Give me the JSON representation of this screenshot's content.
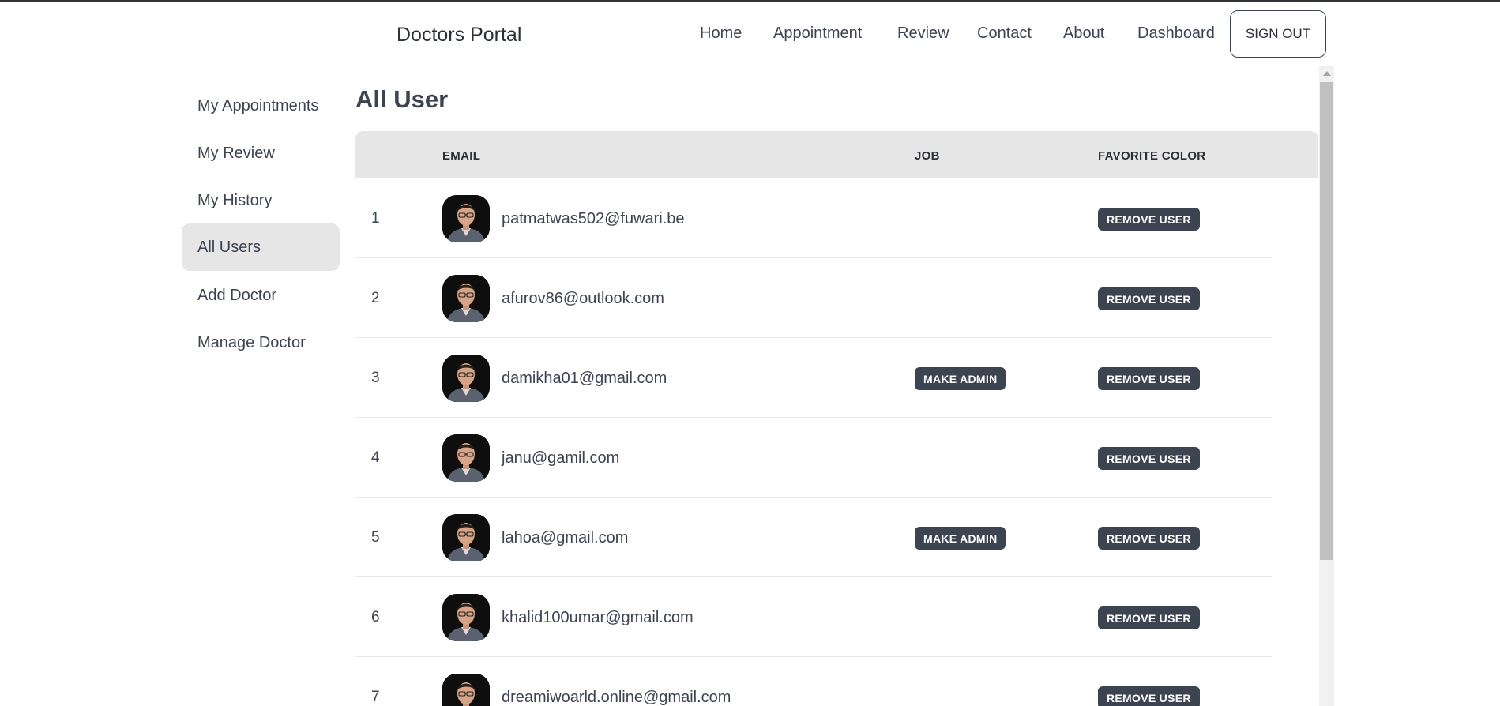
{
  "header": {
    "brand": "Doctors Portal",
    "nav": [
      "Home",
      "Appointment",
      "Review",
      "Contact",
      "About",
      "Dashboard"
    ],
    "signout_label": "SIGN OUT"
  },
  "sidebar": {
    "items": [
      {
        "label": "My Appointments"
      },
      {
        "label": "My Review"
      },
      {
        "label": "My History"
      },
      {
        "label": "All Users",
        "active": true
      },
      {
        "label": "Add Doctor"
      },
      {
        "label": "Manage Doctor"
      }
    ]
  },
  "main": {
    "title": "All User",
    "columns": [
      "",
      "EMAIL",
      "JOB",
      "FAVORITE COLOR"
    ],
    "make_admin_label": "MAKE ADMIN",
    "remove_user_label": "REMOVE USER",
    "rows": [
      {
        "index": "1",
        "email": "patmatwas502@fuwari.be",
        "make_admin": false
      },
      {
        "index": "2",
        "email": "afurov86@outlook.com",
        "make_admin": false
      },
      {
        "index": "3",
        "email": "damikha01@gmail.com",
        "make_admin": true
      },
      {
        "index": "4",
        "email": "janu@gamil.com",
        "make_admin": false
      },
      {
        "index": "5",
        "email": "lahoa@gmail.com",
        "make_admin": true
      },
      {
        "index": "6",
        "email": "khalid100umar@gmail.com",
        "make_admin": false
      },
      {
        "index": "7",
        "email": "dreamiwoarld.online@gmail.com",
        "make_admin": false
      }
    ]
  },
  "colors": {
    "accent": "#3d4451",
    "active_bg": "#e6e6e6",
    "header_bg": "#e6e6e6"
  },
  "icons": {
    "scroll_up": "chevron-up-icon",
    "avatar": "user-avatar-photo"
  }
}
